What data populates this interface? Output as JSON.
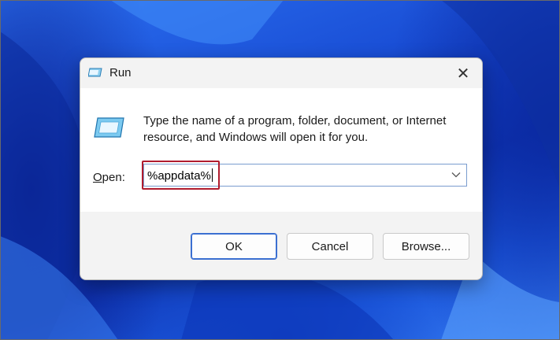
{
  "window": {
    "title": "Run",
    "close_label": "✕"
  },
  "content": {
    "description": "Type the name of a program, folder, document, or Internet resource, and Windows will open it for you.",
    "open_label_accel": "O",
    "open_label_rest": "pen:",
    "open_value": "%appdata%"
  },
  "buttons": {
    "ok": "OK",
    "cancel": "Cancel",
    "browse": "Browse..."
  },
  "colors": {
    "accent": "#3b6fd1",
    "highlight": "#b01c2e"
  },
  "icons": [
    "run-app-icon",
    "close-icon",
    "chevron-down-icon"
  ]
}
